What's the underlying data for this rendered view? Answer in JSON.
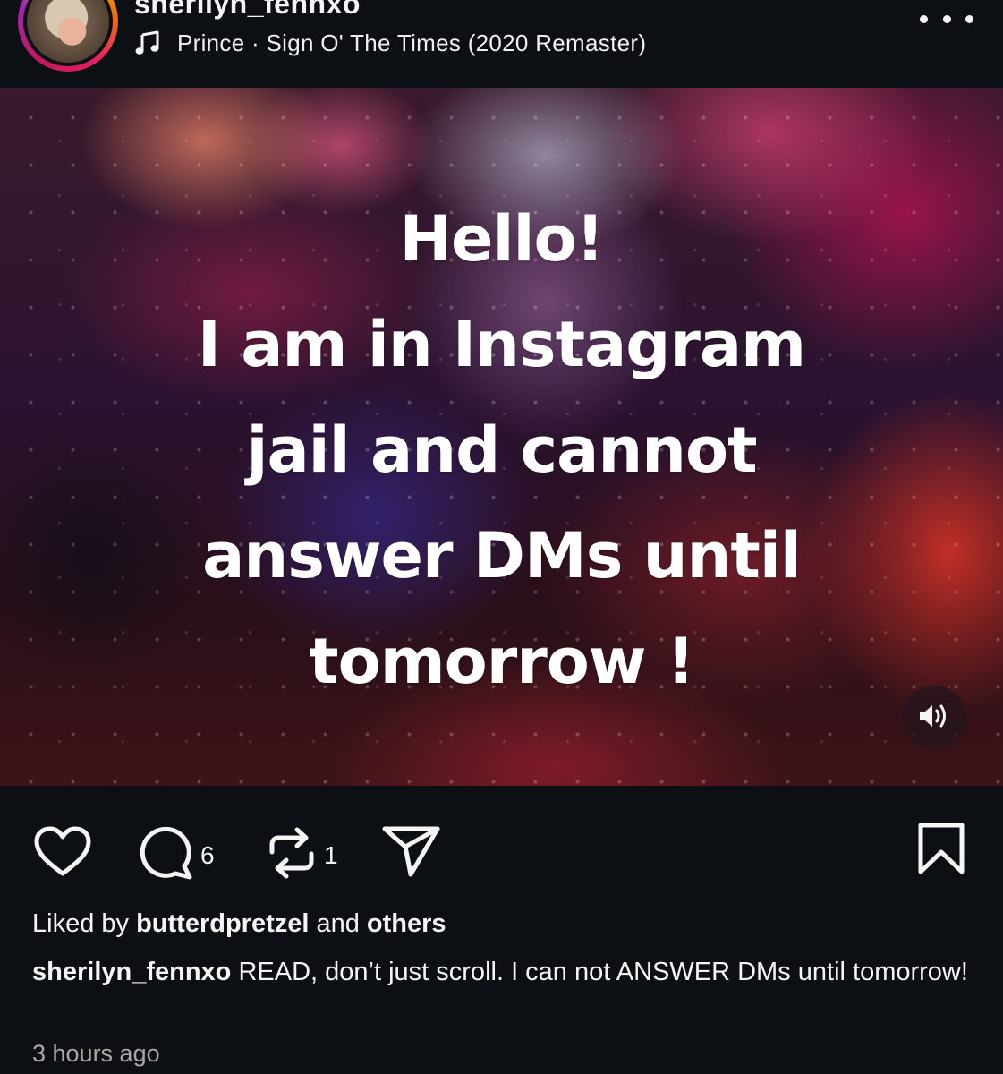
{
  "post": {
    "username": "sherilyn_fennxo",
    "music_icon": "music-note-icon",
    "music": "Prince · Sign O' The Times (2020 Remaster)",
    "more_icon": "more-horizontal-icon"
  },
  "media": {
    "text": "Hello!\nI am in Instagram\njail and cannot\nanswer DMs until\ntomorrow !",
    "sound_icon": "speaker-icon"
  },
  "actions": {
    "like_icon": "heart-icon",
    "comment_icon": "comment-bubble-icon",
    "comment_count": "6",
    "repost_icon": "repost-icon",
    "repost_count": "1",
    "share_icon": "send-icon",
    "save_icon": "bookmark-icon"
  },
  "likes": {
    "prefix": "Liked by ",
    "user": "butterdpretzel",
    "middle": " and ",
    "others": "others"
  },
  "caption": {
    "username": "sherilyn_fennxo",
    "text": " READ, don’t just scroll. I can not ANSWER DMs until tomorrow!"
  },
  "timestamp": "3 hours ago",
  "colors": {
    "background": "#0c1014",
    "text": "#f5f5f5",
    "muted": "#a8a8a8"
  }
}
